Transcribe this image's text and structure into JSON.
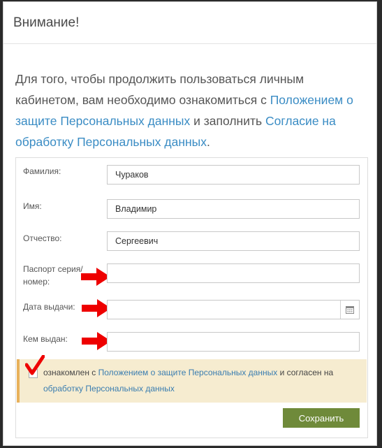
{
  "modal": {
    "title": "Внимание!"
  },
  "intro": {
    "text_1": "Для того, чтобы продолжить пользоваться личным кабинетом, вам необходимо ознакомиться с ",
    "link_1": "Положением о защите Персональных данных",
    "text_2": " и заполнить ",
    "link_2": "Согласие на обработку Персональных данных",
    "text_3": "."
  },
  "form": {
    "fields": [
      {
        "label": "Фамилия:",
        "value": "Чураков"
      },
      {
        "label": "Имя:",
        "value": "Владимир"
      },
      {
        "label": "Отчество:",
        "value": "Сергеевич"
      },
      {
        "label": "Паспорт серия/ номер:",
        "value": ""
      },
      {
        "label": "Дата выдачи:",
        "value": ""
      },
      {
        "label": "Кем выдан:",
        "value": ""
      }
    ],
    "consent": {
      "text_1": "ознакомлен с ",
      "link_1": "Положением о защите Персональных данных",
      "text_2": " и согласен на ",
      "link_2": "обработку Персональных данных",
      "checked": true
    },
    "save_label": "Сохранить"
  },
  "colors": {
    "link": "#3a8cc4",
    "save_button": "#6f8a3a",
    "alert_bg": "#f6ecd0",
    "alert_border": "#e8b15a",
    "annotation": "#ee0000"
  },
  "icons": {
    "calendar": "calendar-icon",
    "arrow": "red-arrow-annotation",
    "check": "red-checkmark-annotation"
  }
}
